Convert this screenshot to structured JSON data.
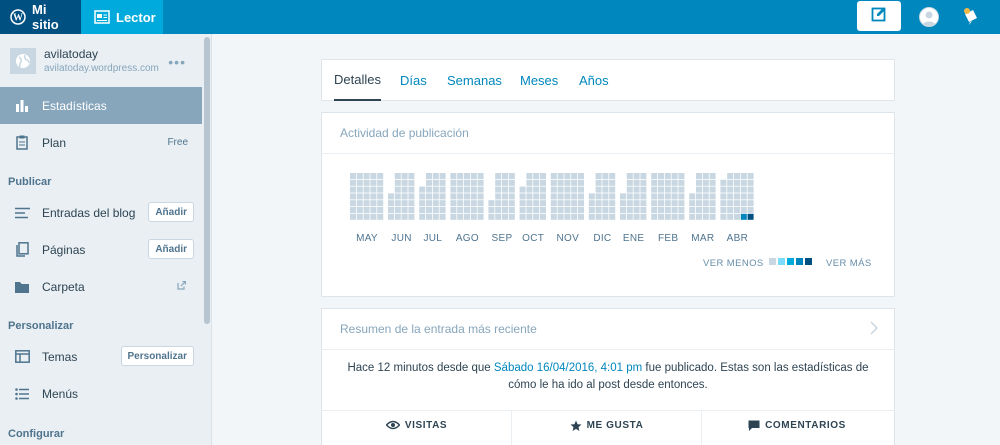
{
  "masterbar": {
    "my_site": "Mi sitio",
    "reader": "Lector"
  },
  "site": {
    "name": "avilatoday",
    "url": "avilatoday.wordpress.com"
  },
  "sidebar": {
    "stats": "Estadísticas",
    "plan": {
      "label": "Plan",
      "badge": "Free"
    },
    "sections": {
      "publish": "Publicar",
      "personalize": "Personalizar",
      "configure": "Configurar"
    },
    "posts": {
      "label": "Entradas del blog",
      "button": "Añadir"
    },
    "pages": {
      "label": "Páginas",
      "button": "Añadir"
    },
    "folder": "Carpeta",
    "themes": {
      "label": "Temas",
      "button": "Personalizar"
    },
    "menus": "Menús"
  },
  "tabs": [
    "Detalles",
    "Días",
    "Semanas",
    "Meses",
    "Años"
  ],
  "activity": {
    "title": "Actividad de publicación",
    "months": [
      "MAY",
      "JUN",
      "JUL",
      "AGO",
      "SEP",
      "OCT",
      "NOV",
      "DIC",
      "ENE",
      "FEB",
      "MAR",
      "ABR"
    ],
    "legend_less": "VER MENOS",
    "legend_more": "VER MÁS",
    "legend_colors": [
      "#c8d7e1",
      "#78dcfa",
      "#00aadc",
      "#0085be",
      "#005082"
    ],
    "highlight_colors": {
      "hot": "#0085be",
      "dark": "#005082"
    }
  },
  "summary": {
    "title": "Resumen de la entrada más reciente",
    "text_before": "Hace 12 minutos desde que ",
    "link": "Sábado 16/04/2016, 4:01 pm",
    "text_after": " fue publicado. Estas son las estadísticas de cómo le ha ido al post desde entonces.",
    "stats": [
      "VISITAS",
      "ME GUSTA",
      "COMENTARIOS"
    ]
  }
}
